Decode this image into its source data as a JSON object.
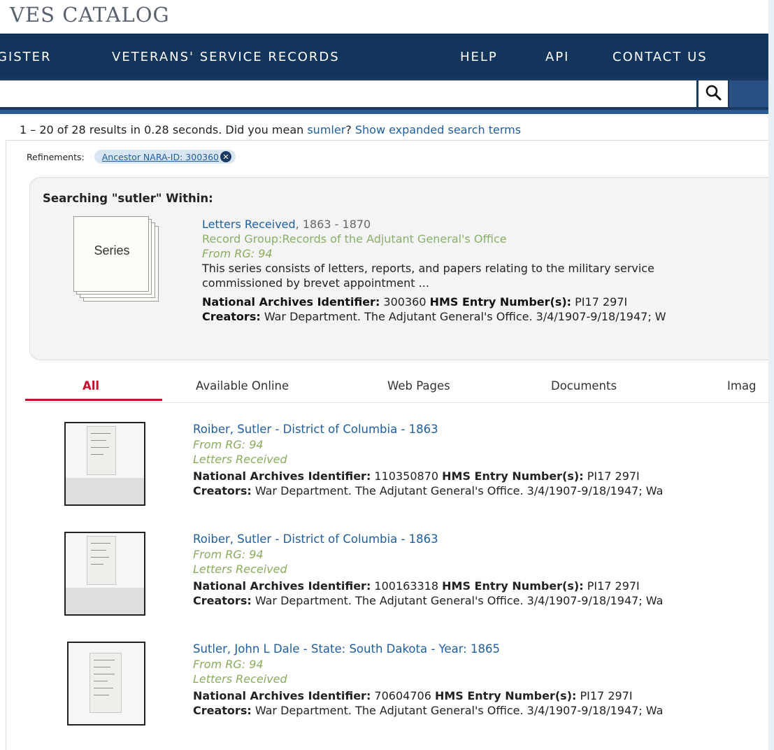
{
  "site": {
    "title": "VES CATALOG"
  },
  "nav": {
    "items": [
      {
        "label": "GISTER"
      },
      {
        "label": "VETERANS' SERVICE RECORDS"
      },
      {
        "label": "HELP"
      },
      {
        "label": "API"
      },
      {
        "label": "CONTACT US"
      }
    ]
  },
  "search": {
    "value": "",
    "placeholder": ""
  },
  "summary": {
    "text": "1 – 20 of 28 results in 0.28 seconds. Did you mean ",
    "suggestion": "sumler",
    "qmark": "? ",
    "expanded_link": "Show expanded search terms"
  },
  "refinements": {
    "label": "Refinements:",
    "chip": "Ancestor NARA-ID: 300360",
    "remove_glyph": "✕"
  },
  "within": {
    "heading": "Searching \"sutler\" Within:",
    "series_label": "Series",
    "title": "Letters Received",
    "dates": ", 1863 - 1870",
    "record_group": "Record Group:Records of the Adjutant General's Office",
    "from_rg": "From RG: 94",
    "description_1": "This series consists of letters, reports, and papers relating to the military service",
    "description_2": "commissioned by brevet appointment ...",
    "nai_label": "National Archives Identifier:",
    "nai_value": " 300360 ",
    "hms_label": " HMS Entry Number(s):",
    "hms_value": " PI17 297I",
    "creators_label": "Creators:",
    "creators_value": " War Department. The Adjutant General's Office. 3/4/1907-9/18/1947; W"
  },
  "tabs": [
    {
      "label": "All"
    },
    {
      "label": "Available Online"
    },
    {
      "label": "Web Pages"
    },
    {
      "label": "Documents"
    },
    {
      "label": "Imag"
    }
  ],
  "results": [
    {
      "title": "Roiber, Sutler - District of Columbia - 1863",
      "from_rg": "From RG: 94",
      "series": "Letters Received",
      "nai_label": "National Archives Identifier:",
      "nai_value": " 110350870 ",
      "hms_label": " HMS Entry Number(s):",
      "hms_value": " PI17 297I",
      "creators_label": "Creators:",
      "creators_value": " War Department. The Adjutant General's Office. 3/4/1907-9/18/1947; Wa"
    },
    {
      "title": "Roiber, Sutler - District of Columbia - 1863",
      "from_rg": "From RG: 94",
      "series": "Letters Received",
      "nai_label": "National Archives Identifier:",
      "nai_value": " 100163318 ",
      "hms_label": " HMS Entry Number(s):",
      "hms_value": " PI17 297I",
      "creators_label": "Creators:",
      "creators_value": " War Department. The Adjutant General's Office. 3/4/1907-9/18/1947; Wa"
    },
    {
      "title": "Sutler, John L Dale - State: South Dakota - Year: 1865",
      "from_rg": "From RG: 94",
      "series": "Letters Received",
      "nai_label": "National Archives Identifier:",
      "nai_value": " 70604706 ",
      "hms_label": " HMS Entry Number(s):",
      "hms_value": " PI17 297I",
      "creators_label": "Creators:",
      "creators_value": " War Department. The Adjutant General's Office. 3/4/1907-9/18/1947; Wa"
    }
  ],
  "colors": {
    "nav_bg": "#13355c",
    "link": "#1f5fa0",
    "accent_red": "#c8102e",
    "record_group_green": "#88b06a"
  }
}
